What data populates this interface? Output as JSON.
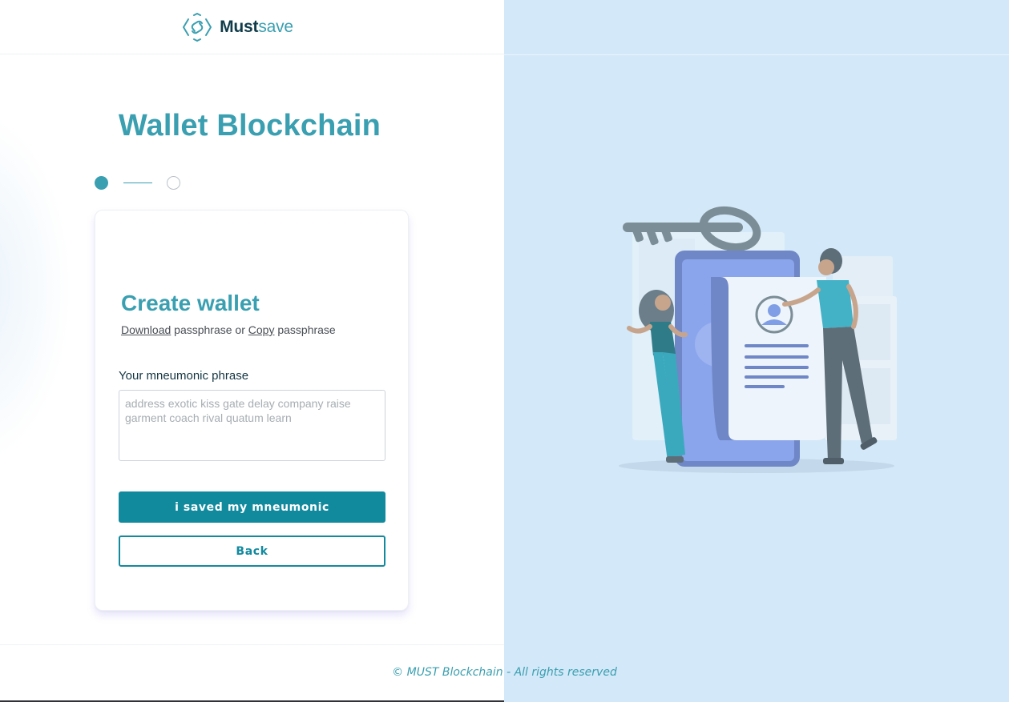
{
  "brand": {
    "name_part1": "Must",
    "name_part2": "save",
    "icon": "hexagon-link-logo-icon"
  },
  "page": {
    "title": "Wallet Blockchain"
  },
  "stepper": {
    "current_step": 1,
    "total_steps": 2
  },
  "card": {
    "title": "Create wallet",
    "subtitle": {
      "download_link": "Download",
      "text_after_download": " passphrase or ",
      "copy_link": "Copy",
      "text_after_copy": " passphrase"
    },
    "field_label": "Your mneumonic phrase",
    "mnemonic_placeholder": "address exotic kiss gate delay company raise garment coach rival quatum learn",
    "mnemonic_value": "",
    "primary_button": "i saved my mneumonic",
    "secondary_button": "Back"
  },
  "footer": {
    "text": "© MUST Blockchain - All rights reserved"
  },
  "colors": {
    "accent": "#3a9fb0",
    "button": "#128a9e",
    "brand_dark": "#0f3b4a",
    "right_panel_bg": "#d3e8f8"
  }
}
